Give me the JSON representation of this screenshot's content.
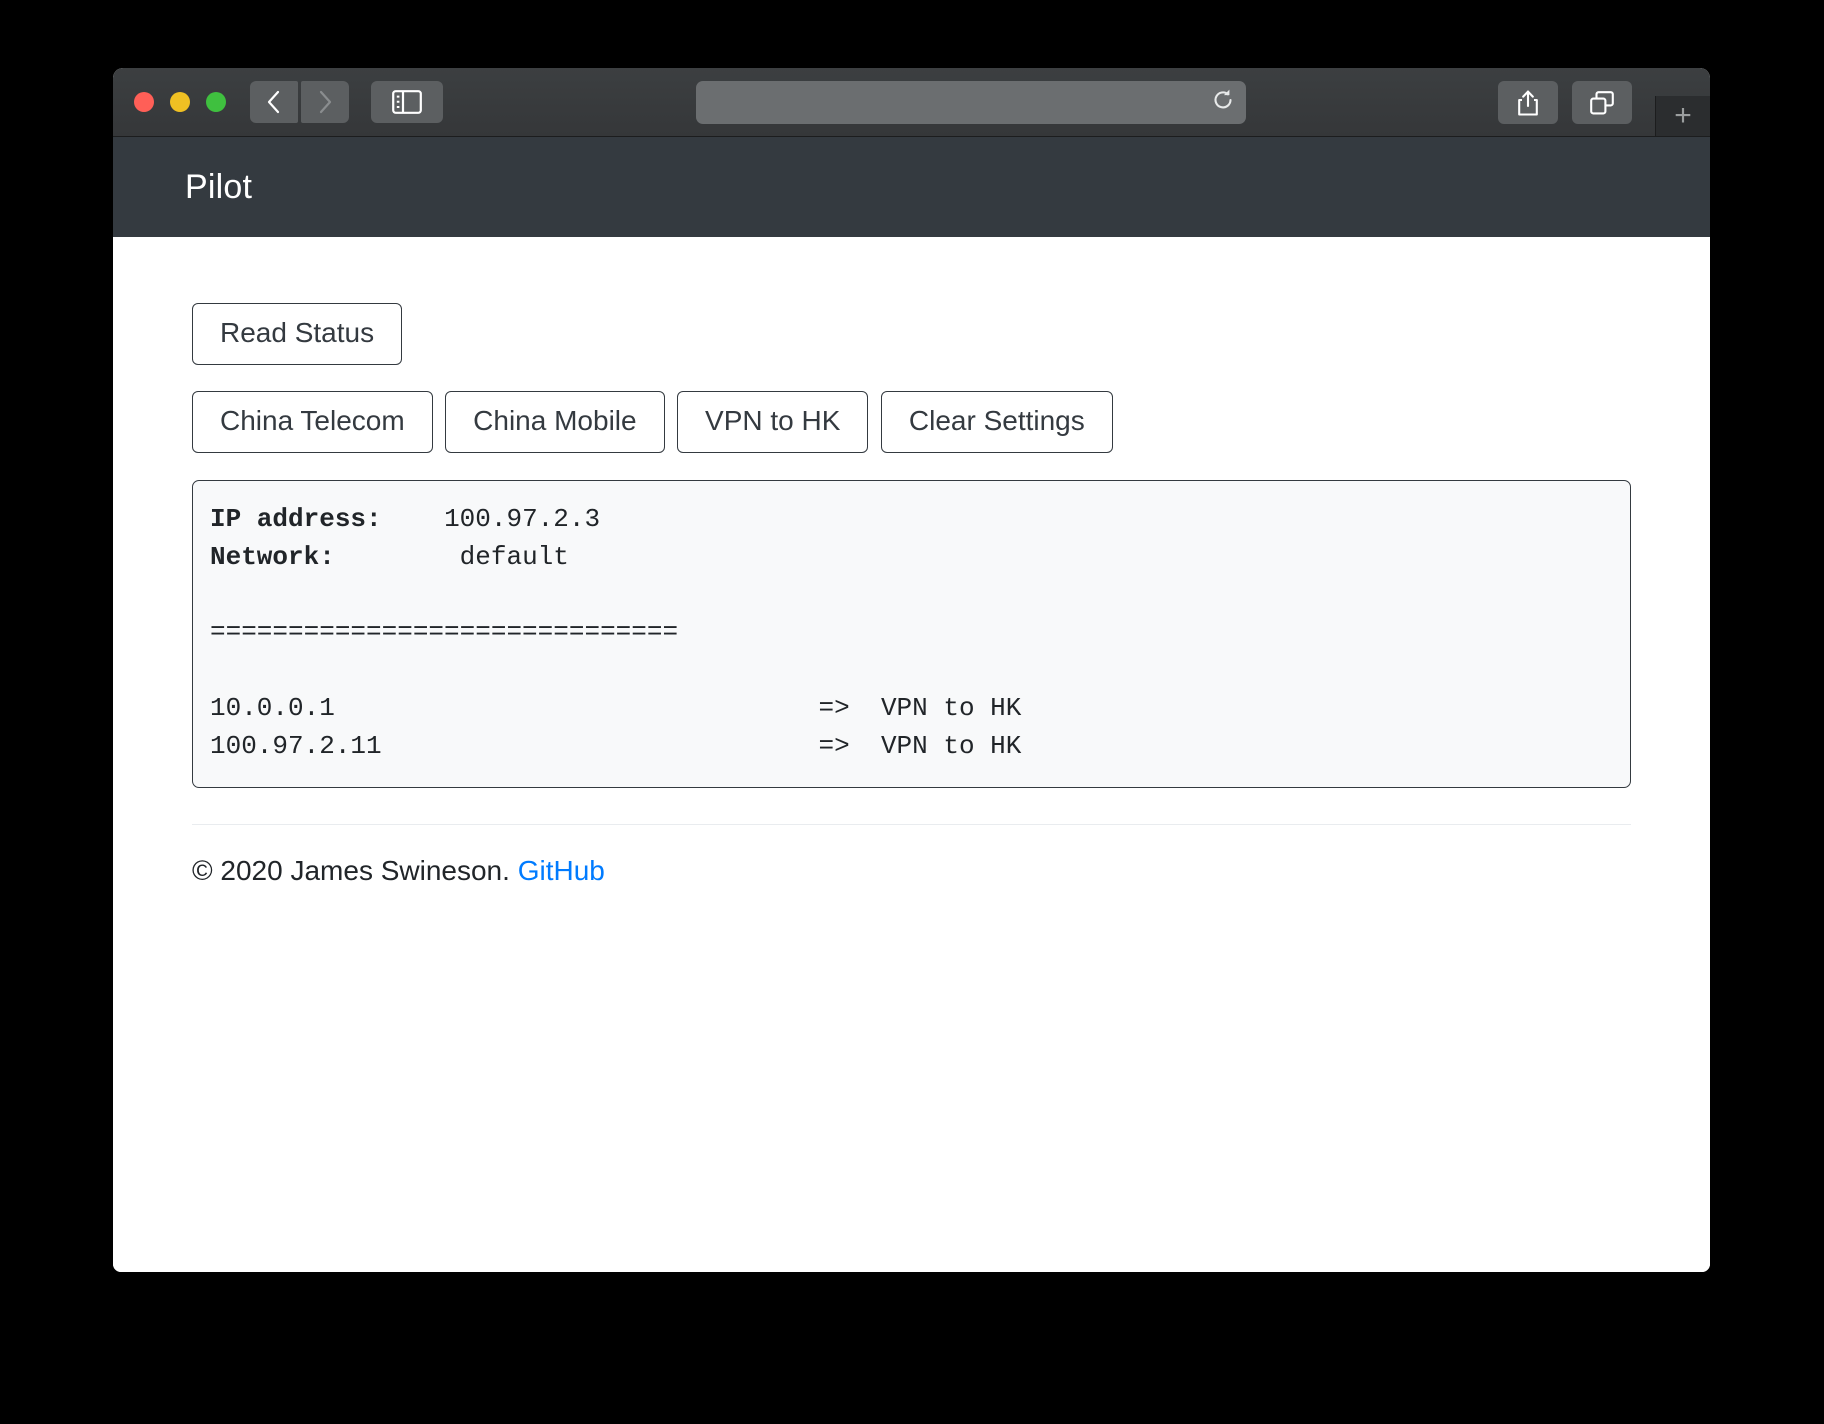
{
  "browser": {
    "traffic_lights": [
      "close",
      "minimize",
      "zoom"
    ],
    "back_label": "Back",
    "forward_label": "Forward",
    "sidebar_label": "Show Sidebar",
    "address_value": "",
    "address_placeholder": "",
    "reload_label": "Reload",
    "share_label": "Share",
    "tab_overview_label": "Show Tab Overview",
    "new_tab_label": "+"
  },
  "navbar": {
    "brand": "Pilot"
  },
  "actions": {
    "read_status": "Read Status",
    "china_telecom": "China Telecom",
    "china_mobile": "China Mobile",
    "vpn_to_hk": "VPN to HK",
    "clear_settings": "Clear Settings"
  },
  "output": {
    "ip_label": "IP address:",
    "ip_value": "100.97.2.3",
    "network_label": "Network:",
    "network_value": "default",
    "separator": "==============================",
    "routes": [
      {
        "source": "10.0.0.1",
        "arrow": "=>",
        "target": "VPN to HK"
      },
      {
        "source": "100.97.2.11",
        "arrow": "=>",
        "target": "VPN to HK"
      }
    ]
  },
  "footer": {
    "copyright": "© 2020 James Swineson.",
    "link_label": "GitHub"
  },
  "colors": {
    "navbar_bg": "#343a40",
    "accent_link": "#007bff",
    "output_bg": "#f8f9fa",
    "border_dark": "#343a40"
  }
}
